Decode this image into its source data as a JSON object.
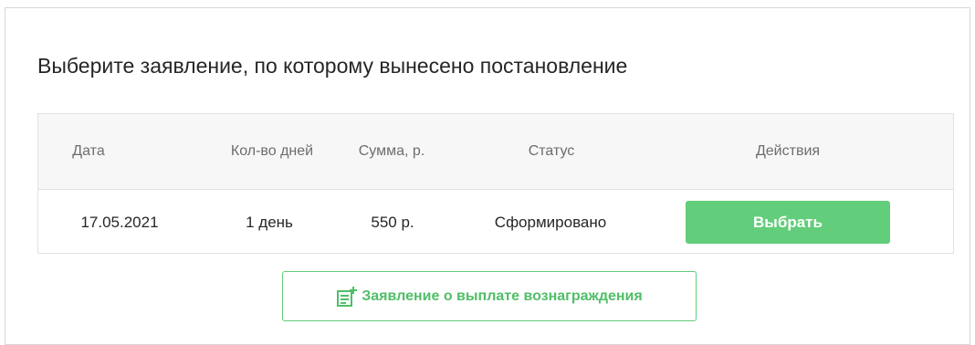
{
  "page_title": "Выберите заявление, по которому вынесено постановление",
  "table": {
    "headers": {
      "date": "Дата",
      "days": "Кол-во дней",
      "amount": "Сумма, р.",
      "status": "Статус",
      "actions": "Действия"
    },
    "rows": [
      {
        "date": "17.05.2021",
        "days": "1 день",
        "amount": "550 р.",
        "status": "Сформировано",
        "action_label": "Выбрать"
      }
    ]
  },
  "add_application_button": {
    "label": "Заявление о выплате вознаграждения",
    "icon": "note-add-icon"
  },
  "colors": {
    "accent": "#62cd7a",
    "accent_text": "#4fbf67",
    "header_bg": "#f7f7f7",
    "border": "#e2e2e2"
  }
}
